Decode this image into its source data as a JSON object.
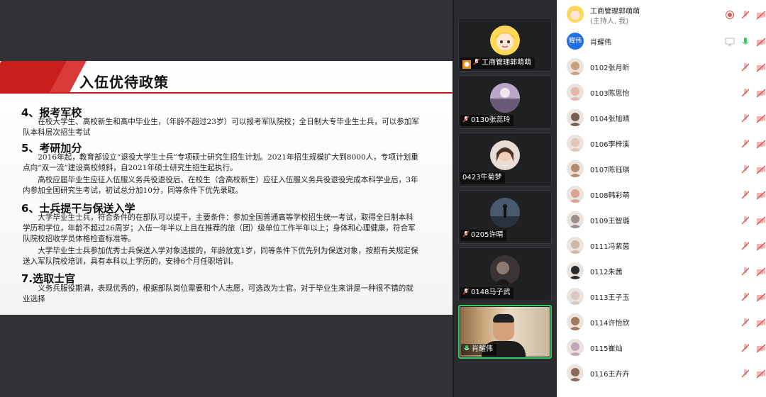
{
  "slide": {
    "title": "入伍优待政策",
    "sections": [
      {
        "heading": "4、报考军校",
        "paragraphs": [
          "在校大学生、高校新生和高中毕业生，（年龄不超过23岁）可以报考军队院校；全日制大专毕业生士兵，可以参加军队本科层次招生考试"
        ]
      },
      {
        "heading": "5、考研加分",
        "paragraphs": [
          "2016年起，教育部设立“退役大学生士兵”专项硕士研究生招生计划。2021年招生规模扩大到8000人，专项计划重点向“双一流”建设高校倾斜，自2021年硕士研究生招生起执行。",
          "高校应届毕业生应征入伍服义务兵役退役后、在校生（含高校新生）应征入伍服义务兵役退役完成本科学业后，3年内参加全国研究生考试，初试总分加10分，同等条件下优先录取。"
        ]
      },
      {
        "heading": "6、士兵提干与保送入学",
        "paragraphs": [
          "大学毕业生士兵，符合条件的在部队可以提干，主要条件：参加全国普通高等学校招生统一考试，取得全日制本科学历和学位，年龄不超过26周岁；入伍一年半以上且在推荐的旅（团）级单位工作半年以上；身体和心理健康，符合军队院校招收学员体格检查标准等。",
          "大学毕业生士兵参加优秀士兵保送入学对象选拔的，年龄放宽1岁，同等条件下优先列为保送对象，按照有关规定保送入军队院校培训，具有本科以上学历的，安排6个月任职培训。"
        ]
      },
      {
        "heading": "7.选取士官",
        "paragraphs": [
          "义务兵服役期满，表现优秀的，根据部队岗位需要和个人志愿，可选改为士官。对于毕业生来讲是一种很不错的就业选择"
        ]
      }
    ]
  },
  "video_tiles": [
    {
      "name": "工商管理郭萌萌",
      "avatar": "cartoon-avatar",
      "host": true
    },
    {
      "name": "0130张蕊玲",
      "avatar": "photo-avatar"
    },
    {
      "name": "0423牛菊梦",
      "avatar": "photo-avatar"
    },
    {
      "name": "0205许晴",
      "avatar": "photo-avatar"
    },
    {
      "name": "0148马子武",
      "avatar": "photo-avatar"
    },
    {
      "name": "肖耀伟",
      "avatar": "camera-video",
      "speaking": true
    }
  ],
  "participants": [
    {
      "name": "工商管理郭萌萌",
      "sub": "(主持人, 我)",
      "avatar": "cartoon",
      "recording": true
    },
    {
      "name": "肖耀伟",
      "avatar_text": "耀伟",
      "screen": true,
      "mic_on": true
    },
    {
      "name": "0102张月昕"
    },
    {
      "name": "0103陈思怡"
    },
    {
      "name": "0104张旭晴"
    },
    {
      "name": "0106李梓溪"
    },
    {
      "name": "0107陈钰琪"
    },
    {
      "name": "0108韩彩萌"
    },
    {
      "name": "0109王智璐"
    },
    {
      "name": "0111冯紫茵"
    },
    {
      "name": "0112朱茜"
    },
    {
      "name": "0113王子玉"
    },
    {
      "name": "0114许怡欣"
    },
    {
      "name": "0115崔灿"
    },
    {
      "name": "0116王卉卉"
    }
  ],
  "colors": {
    "accent_red": "#c81e1e",
    "mic_muted": "#e05252",
    "active_green": "#35c759",
    "host_blue": "#1f6fe5"
  }
}
